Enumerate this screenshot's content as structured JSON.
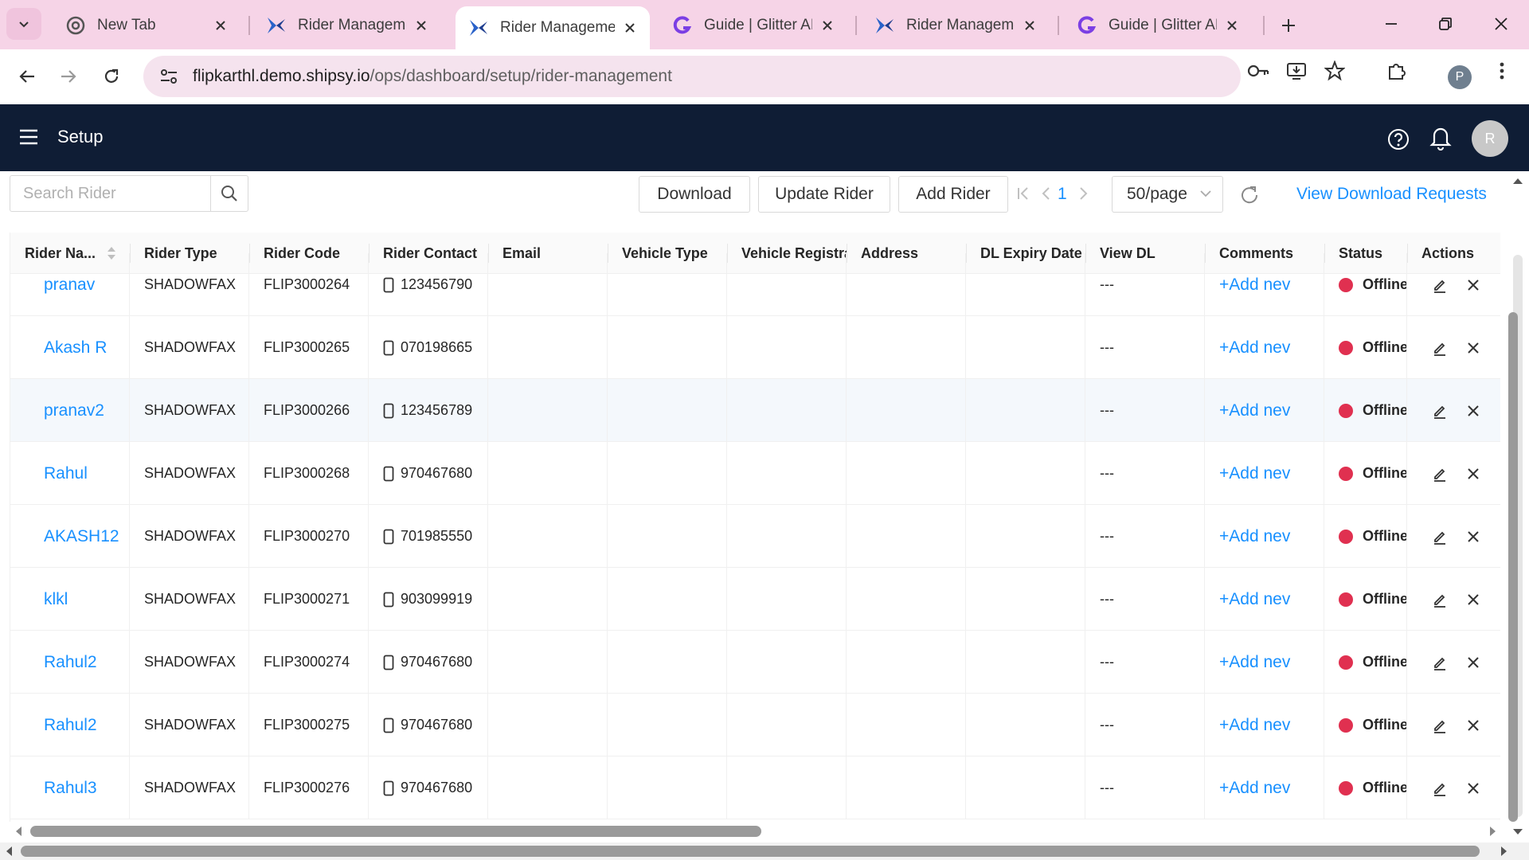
{
  "browser": {
    "tabs": [
      {
        "title": "New Tab",
        "favicon": "chrome-icon",
        "active": false
      },
      {
        "title": "Rider Managemen",
        "favicon": "shipsy-icon",
        "active": false
      },
      {
        "title": "Rider Managemen",
        "favicon": "shipsy-icon",
        "active": true
      },
      {
        "title": "Guide | Glitter AI",
        "favicon": "glitter-icon",
        "active": false
      },
      {
        "title": "Rider Managemen",
        "favicon": "shipsy-icon",
        "active": false
      },
      {
        "title": "Guide | Glitter AI",
        "favicon": "glitter-icon",
        "active": false
      }
    ],
    "url_domain": "flipkarthl.demo.shipsy.io",
    "url_path": "/ops/dashboard/setup/rider-management",
    "profile_initial": "P",
    "colors": {
      "tabstrip": "#f6d4e7",
      "omnibox": "#f5e3ee"
    }
  },
  "app": {
    "title": "Setup",
    "avatar_initial": "R",
    "colors": {
      "header": "#0f1d35",
      "link": "#1890ff",
      "offline": "#e03050"
    }
  },
  "controls": {
    "search_placeholder": "Search Rider",
    "download_label": "Download",
    "update_label": "Update Rider",
    "add_label": "Add Rider",
    "page": "1",
    "page_size": "50/page",
    "download_requests_label": "View Download Requests"
  },
  "table": {
    "columns": [
      "Rider Na...",
      "Rider Type",
      "Rider Code",
      "Rider Contact",
      "Email",
      "Vehicle Type",
      "Vehicle Registra",
      "Address",
      "DL Expiry Date",
      "View DL",
      "Comments",
      "Status",
      "Actions"
    ],
    "rows": [
      {
        "name": "pranav",
        "type": "SHADOWFAX",
        "code": "FLIP3000264",
        "contact": "123456790",
        "email": "",
        "vehicle_type": "",
        "vehicle_reg": "",
        "address": "",
        "dl_expiry": "",
        "view_dl": "---",
        "comments": "+Add nev",
        "status": "Offline"
      },
      {
        "name": "Akash R",
        "type": "SHADOWFAX",
        "code": "FLIP3000265",
        "contact": "070198665",
        "email": "",
        "vehicle_type": "",
        "vehicle_reg": "",
        "address": "",
        "dl_expiry": "",
        "view_dl": "---",
        "comments": "+Add nev",
        "status": "Offline"
      },
      {
        "name": "pranav2",
        "type": "SHADOWFAX",
        "code": "FLIP3000266",
        "contact": "123456789",
        "email": "",
        "vehicle_type": "",
        "vehicle_reg": "",
        "address": "",
        "dl_expiry": "",
        "view_dl": "---",
        "comments": "+Add nev",
        "status": "Offline"
      },
      {
        "name": "Rahul",
        "type": "SHADOWFAX",
        "code": "FLIP3000268",
        "contact": "970467680",
        "email": "",
        "vehicle_type": "",
        "vehicle_reg": "",
        "address": "",
        "dl_expiry": "",
        "view_dl": "---",
        "comments": "+Add nev",
        "status": "Offline"
      },
      {
        "name": "AKASH12",
        "type": "SHADOWFAX",
        "code": "FLIP3000270",
        "contact": "701985550",
        "email": "",
        "vehicle_type": "",
        "vehicle_reg": "",
        "address": "",
        "dl_expiry": "",
        "view_dl": "---",
        "comments": "+Add nev",
        "status": "Offline"
      },
      {
        "name": "klkl",
        "type": "SHADOWFAX",
        "code": "FLIP3000271",
        "contact": "903099919",
        "email": "",
        "vehicle_type": "",
        "vehicle_reg": "",
        "address": "",
        "dl_expiry": "",
        "view_dl": "---",
        "comments": "+Add nev",
        "status": "Offline"
      },
      {
        "name": "Rahul2",
        "type": "SHADOWFAX",
        "code": "FLIP3000274",
        "contact": "970467680",
        "email": "",
        "vehicle_type": "",
        "vehicle_reg": "",
        "address": "",
        "dl_expiry": "",
        "view_dl": "---",
        "comments": "+Add nev",
        "status": "Offline"
      },
      {
        "name": "Rahul2",
        "type": "SHADOWFAX",
        "code": "FLIP3000275",
        "contact": "970467680",
        "email": "",
        "vehicle_type": "",
        "vehicle_reg": "",
        "address": "",
        "dl_expiry": "",
        "view_dl": "---",
        "comments": "+Add nev",
        "status": "Offline"
      },
      {
        "name": "Rahul3",
        "type": "SHADOWFAX",
        "code": "FLIP3000276",
        "contact": "970467680",
        "email": "",
        "vehicle_type": "",
        "vehicle_reg": "",
        "address": "",
        "dl_expiry": "",
        "view_dl": "---",
        "comments": "+Add nev",
        "status": "Offline"
      }
    ]
  }
}
